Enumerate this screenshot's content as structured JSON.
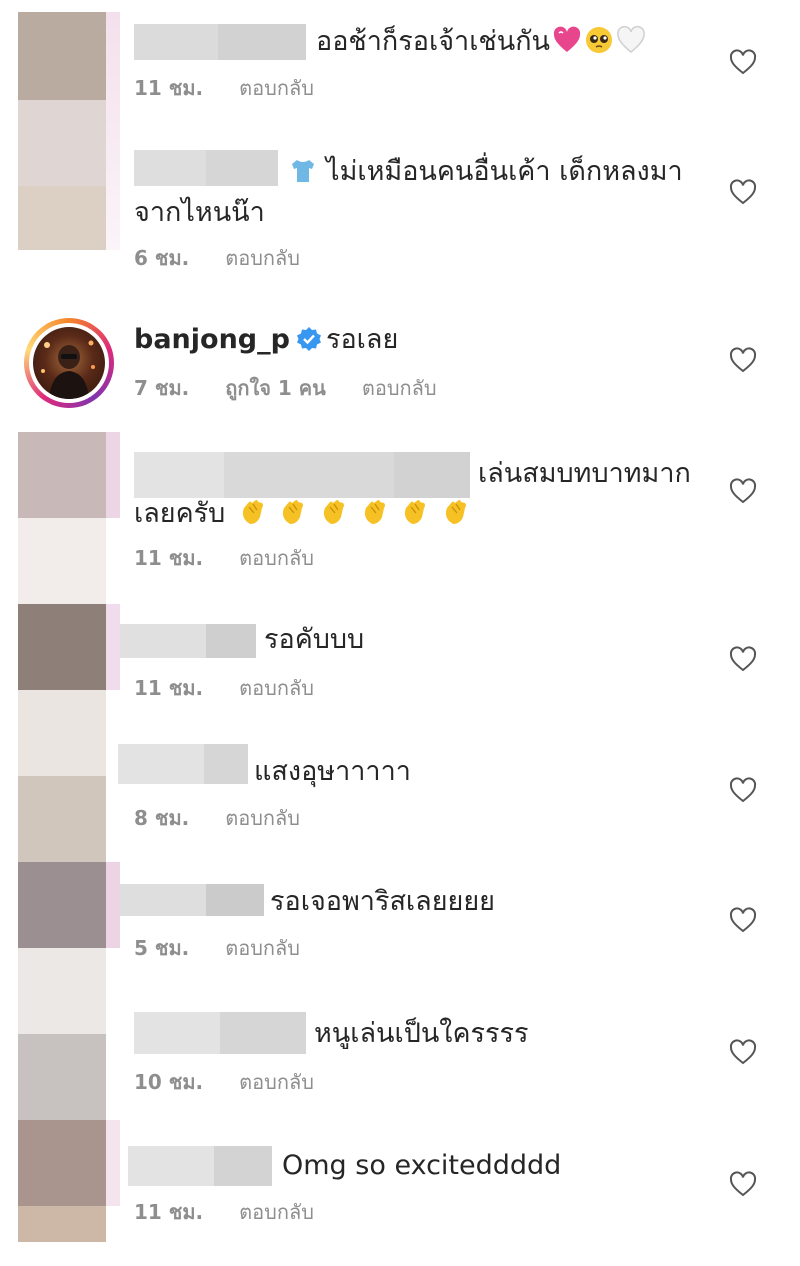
{
  "colors": {
    "meta": "#8e8e8e",
    "text": "#262626",
    "verified": "#3897f0"
  },
  "comments": [
    {
      "text": "ออช้าก็รอเจ้าเช่นกัน",
      "emojis": [
        "heart-icon",
        "pleading-face-icon",
        "white-heart-icon"
      ],
      "time": "11 ชม.",
      "reply": "ตอบกลับ"
    },
    {
      "text_line1": "ไม่เหมือนคนอื่นเค้า เด็กหลงมา",
      "text_line2": "จากไหนน๊า",
      "emojis": [
        "tshirt-icon"
      ],
      "time": "6 ชม.",
      "reply": "ตอบกลับ"
    },
    {
      "username": "banjong_p",
      "text": "รอเลย",
      "time": "7 ชม.",
      "likes": "ถูกใจ 1 คน",
      "reply": "ตอบกลับ"
    },
    {
      "text_line1": "เล่นสมบทบาทมาก",
      "text_line2": "เลยครับ",
      "emojis": [
        "clapping-hands-icon"
      ],
      "time": "11 ชม.",
      "reply": "ตอบกลับ"
    },
    {
      "text": "รอคับบบ",
      "time": "11 ชม.",
      "reply": "ตอบกลับ"
    },
    {
      "text": "แสงอุษาาาาา",
      "time": "8 ชม.",
      "reply": "ตอบกลับ"
    },
    {
      "text": "รอเจอพาริสเลยยยย",
      "time": "5 ชม.",
      "reply": "ตอบกลับ"
    },
    {
      "text": "หนูเล่นเป็นใครรรร",
      "time": "10 ชม.",
      "reply": "ตอบกลับ"
    },
    {
      "text": "Omg so exciteddddd",
      "time": "11 ชม.",
      "reply": "ตอบกลับ"
    }
  ]
}
